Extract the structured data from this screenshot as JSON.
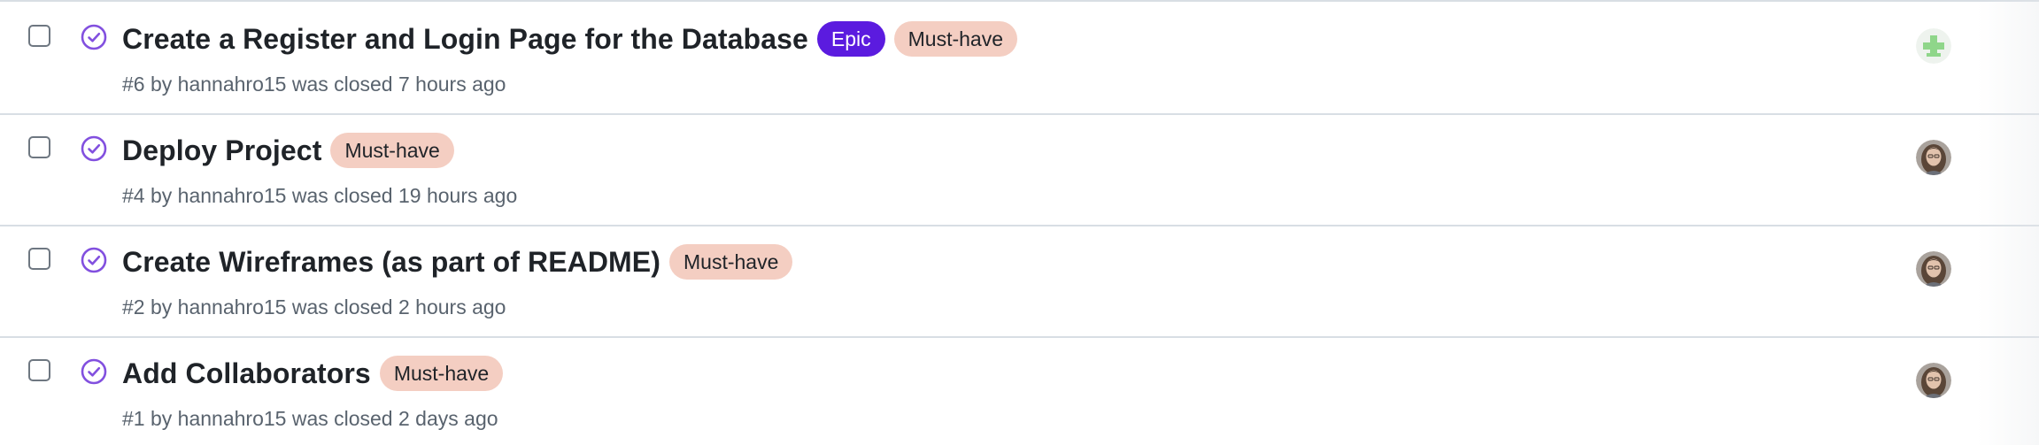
{
  "issues": [
    {
      "title": "Create a Register and Login Page for the Database",
      "labels": [
        {
          "text": "Epic",
          "kind": "epic",
          "color": "#5b1bdf"
        },
        {
          "text": "Must-have",
          "kind": "must",
          "color": "#f4cec2"
        }
      ],
      "meta": "#6 by hannahro15 was closed 7 hours ago",
      "avatar": "identicon-avatar"
    },
    {
      "title": "Deploy Project",
      "labels": [
        {
          "text": "Must-have",
          "kind": "must",
          "color": "#f4cec2"
        }
      ],
      "meta": "#4 by hannahro15 was closed 19 hours ago",
      "avatar": "user-photo-avatar"
    },
    {
      "title": "Create Wireframes (as part of README)",
      "labels": [
        {
          "text": "Must-have",
          "kind": "must",
          "color": "#f4cec2"
        }
      ],
      "meta": "#2 by hannahro15 was closed 2 hours ago",
      "avatar": "user-photo-avatar"
    },
    {
      "title": "Add Collaborators",
      "labels": [
        {
          "text": "Must-have",
          "kind": "must",
          "color": "#f4cec2"
        }
      ],
      "meta": "#1 by hannahro15 was closed 2 days ago",
      "avatar": "user-photo-avatar"
    }
  ],
  "colors": {
    "closed_icon": "#8250df",
    "border": "#d8dee4",
    "meta_text": "#59636e"
  }
}
